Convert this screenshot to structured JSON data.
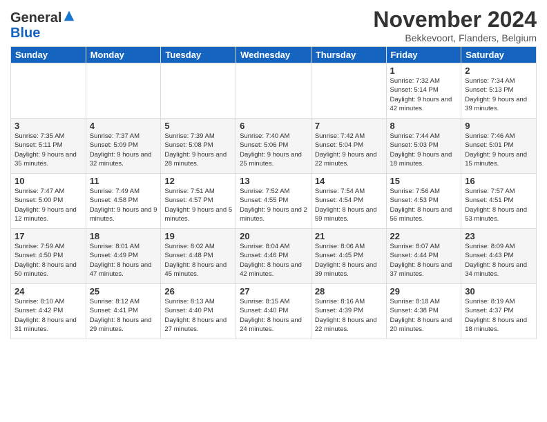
{
  "header": {
    "logo_general": "General",
    "logo_blue": "Blue",
    "month_title": "November 2024",
    "location": "Bekkevoort, Flanders, Belgium"
  },
  "columns": [
    "Sunday",
    "Monday",
    "Tuesday",
    "Wednesday",
    "Thursday",
    "Friday",
    "Saturday"
  ],
  "weeks": [
    [
      {
        "day": "",
        "info": ""
      },
      {
        "day": "",
        "info": ""
      },
      {
        "day": "",
        "info": ""
      },
      {
        "day": "",
        "info": ""
      },
      {
        "day": "",
        "info": ""
      },
      {
        "day": "1",
        "info": "Sunrise: 7:32 AM\nSunset: 5:14 PM\nDaylight: 9 hours\nand 42 minutes."
      },
      {
        "day": "2",
        "info": "Sunrise: 7:34 AM\nSunset: 5:13 PM\nDaylight: 9 hours\nand 39 minutes."
      }
    ],
    [
      {
        "day": "3",
        "info": "Sunrise: 7:35 AM\nSunset: 5:11 PM\nDaylight: 9 hours\nand 35 minutes."
      },
      {
        "day": "4",
        "info": "Sunrise: 7:37 AM\nSunset: 5:09 PM\nDaylight: 9 hours\nand 32 minutes."
      },
      {
        "day": "5",
        "info": "Sunrise: 7:39 AM\nSunset: 5:08 PM\nDaylight: 9 hours\nand 28 minutes."
      },
      {
        "day": "6",
        "info": "Sunrise: 7:40 AM\nSunset: 5:06 PM\nDaylight: 9 hours\nand 25 minutes."
      },
      {
        "day": "7",
        "info": "Sunrise: 7:42 AM\nSunset: 5:04 PM\nDaylight: 9 hours\nand 22 minutes."
      },
      {
        "day": "8",
        "info": "Sunrise: 7:44 AM\nSunset: 5:03 PM\nDaylight: 9 hours\nand 18 minutes."
      },
      {
        "day": "9",
        "info": "Sunrise: 7:46 AM\nSunset: 5:01 PM\nDaylight: 9 hours\nand 15 minutes."
      }
    ],
    [
      {
        "day": "10",
        "info": "Sunrise: 7:47 AM\nSunset: 5:00 PM\nDaylight: 9 hours\nand 12 minutes."
      },
      {
        "day": "11",
        "info": "Sunrise: 7:49 AM\nSunset: 4:58 PM\nDaylight: 9 hours\nand 9 minutes."
      },
      {
        "day": "12",
        "info": "Sunrise: 7:51 AM\nSunset: 4:57 PM\nDaylight: 9 hours\nand 5 minutes."
      },
      {
        "day": "13",
        "info": "Sunrise: 7:52 AM\nSunset: 4:55 PM\nDaylight: 9 hours\nand 2 minutes."
      },
      {
        "day": "14",
        "info": "Sunrise: 7:54 AM\nSunset: 4:54 PM\nDaylight: 8 hours\nand 59 minutes."
      },
      {
        "day": "15",
        "info": "Sunrise: 7:56 AM\nSunset: 4:53 PM\nDaylight: 8 hours\nand 56 minutes."
      },
      {
        "day": "16",
        "info": "Sunrise: 7:57 AM\nSunset: 4:51 PM\nDaylight: 8 hours\nand 53 minutes."
      }
    ],
    [
      {
        "day": "17",
        "info": "Sunrise: 7:59 AM\nSunset: 4:50 PM\nDaylight: 8 hours\nand 50 minutes."
      },
      {
        "day": "18",
        "info": "Sunrise: 8:01 AM\nSunset: 4:49 PM\nDaylight: 8 hours\nand 47 minutes."
      },
      {
        "day": "19",
        "info": "Sunrise: 8:02 AM\nSunset: 4:48 PM\nDaylight: 8 hours\nand 45 minutes."
      },
      {
        "day": "20",
        "info": "Sunrise: 8:04 AM\nSunset: 4:46 PM\nDaylight: 8 hours\nand 42 minutes."
      },
      {
        "day": "21",
        "info": "Sunrise: 8:06 AM\nSunset: 4:45 PM\nDaylight: 8 hours\nand 39 minutes."
      },
      {
        "day": "22",
        "info": "Sunrise: 8:07 AM\nSunset: 4:44 PM\nDaylight: 8 hours\nand 37 minutes."
      },
      {
        "day": "23",
        "info": "Sunrise: 8:09 AM\nSunset: 4:43 PM\nDaylight: 8 hours\nand 34 minutes."
      }
    ],
    [
      {
        "day": "24",
        "info": "Sunrise: 8:10 AM\nSunset: 4:42 PM\nDaylight: 8 hours\nand 31 minutes."
      },
      {
        "day": "25",
        "info": "Sunrise: 8:12 AM\nSunset: 4:41 PM\nDaylight: 8 hours\nand 29 minutes."
      },
      {
        "day": "26",
        "info": "Sunrise: 8:13 AM\nSunset: 4:40 PM\nDaylight: 8 hours\nand 27 minutes."
      },
      {
        "day": "27",
        "info": "Sunrise: 8:15 AM\nSunset: 4:40 PM\nDaylight: 8 hours\nand 24 minutes."
      },
      {
        "day": "28",
        "info": "Sunrise: 8:16 AM\nSunset: 4:39 PM\nDaylight: 8 hours\nand 22 minutes."
      },
      {
        "day": "29",
        "info": "Sunrise: 8:18 AM\nSunset: 4:38 PM\nDaylight: 8 hours\nand 20 minutes."
      },
      {
        "day": "30",
        "info": "Sunrise: 8:19 AM\nSunset: 4:37 PM\nDaylight: 8 hours\nand 18 minutes."
      }
    ]
  ]
}
